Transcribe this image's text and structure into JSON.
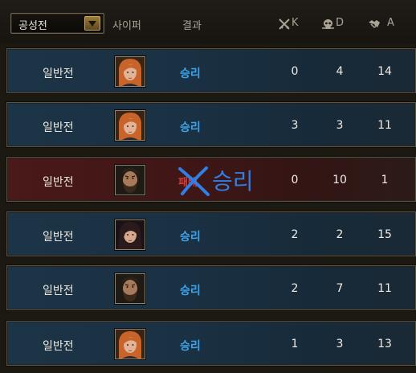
{
  "filter": {
    "selected": "공성전"
  },
  "columns": {
    "cipher": "사이퍼",
    "result": "결과",
    "k": "K",
    "d": "D",
    "a": "A"
  },
  "rows": [
    {
      "mode": "일반전",
      "avatar": "female-orange-hair",
      "result": "승리",
      "k": "0",
      "d": "4",
      "a": "14",
      "outcome": "win"
    },
    {
      "mode": "일반전",
      "avatar": "female-orange-hair",
      "result": "승리",
      "k": "3",
      "d": "3",
      "a": "11",
      "outcome": "win"
    },
    {
      "mode": "일반전",
      "avatar": "bearded-man",
      "result": "패배",
      "correction": "승리",
      "k": "0",
      "d": "10",
      "a": "1",
      "outcome": "loss"
    },
    {
      "mode": "일반전",
      "avatar": "long-dark-hair-man",
      "result": "승리",
      "k": "2",
      "d": "2",
      "a": "15",
      "outcome": "win"
    },
    {
      "mode": "일반전",
      "avatar": "bearded-man",
      "result": "승리",
      "k": "2",
      "d": "7",
      "a": "11",
      "outcome": "win"
    },
    {
      "mode": "일반전",
      "avatar": "female-orange-hair",
      "result": "승리",
      "k": "1",
      "d": "3",
      "a": "13",
      "outcome": "win"
    }
  ],
  "colors": {
    "win": "#3ea3ea",
    "loss": "#d23a36",
    "annotation": "#2f7fe6"
  }
}
